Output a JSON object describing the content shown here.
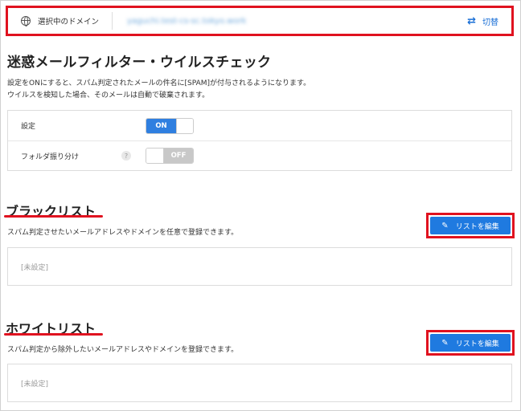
{
  "domain_bar": {
    "label": "選択中のドメイン",
    "value": "yaguchi.test-cs-sc.tokyo.work",
    "switch_label": "切替",
    "switch_icon": "swap-arrows-icon"
  },
  "filter": {
    "title": "迷惑メールフィルター・ウイルスチェック",
    "desc_line1": "設定をONにすると、スパム判定されたメールの件名に[SPAM]が付与されるようになります。",
    "desc_line2": "ウイルスを検知した場合、そのメールは自動で破棄されます。",
    "rows": [
      {
        "label": "設定",
        "state": "ON"
      },
      {
        "label": "フォルダ振り分け",
        "help": "?",
        "state": "OFF"
      }
    ]
  },
  "blacklist": {
    "title": "ブラックリスト",
    "desc": "スパム判定させたいメールアドレスやドメインを任意で登録できます。",
    "edit_label": "リストを編集",
    "empty_text": "[未設定]"
  },
  "whitelist": {
    "title": "ホワイトリスト",
    "desc": "スパム判定から除外したいメールアドレスやドメインを登録できます。",
    "edit_label": "リストを編集",
    "empty_text": "[未設定]"
  },
  "colors": {
    "accent_blue": "#1f7ae0",
    "highlight_red": "#e0121f",
    "toggle_off": "#c8c8c8"
  }
}
